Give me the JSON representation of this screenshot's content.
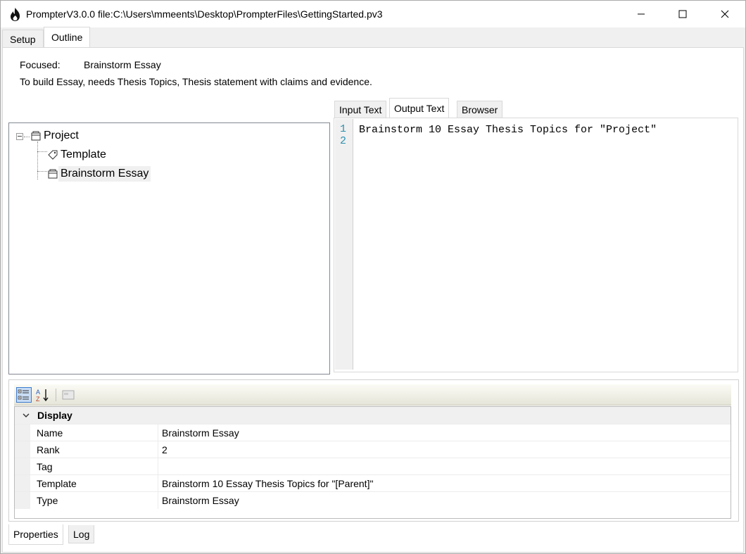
{
  "window": {
    "title": "PrompterV3.0.0 file:C:\\Users\\mmeents\\Desktop\\PrompterFiles\\GettingStarted.pv3"
  },
  "top_tabs": [
    {
      "label": "Setup",
      "active": false
    },
    {
      "label": "Outline",
      "active": true
    }
  ],
  "focus": {
    "label": "Focused:",
    "value": "Brainstorm Essay",
    "description": "To build Essay, needs Thesis Topics, Thesis statement with claims and evidence."
  },
  "tree": {
    "root": "Project",
    "children": [
      "Template",
      "Brainstorm Essay"
    ],
    "selected": "Brainstorm Essay"
  },
  "editor_tabs": [
    {
      "label": "Input Text",
      "active": false
    },
    {
      "label": "Output Text",
      "active": true
    },
    {
      "label": "Browser",
      "active": false
    }
  ],
  "editor": {
    "line_numbers": [
      "1",
      "2"
    ],
    "lines": [
      "Brainstorm 10 Essay Thesis Topics for \"Project\"",
      ""
    ]
  },
  "properties": {
    "category": "Display",
    "rows": [
      {
        "key": "Name",
        "value": "Brainstorm Essay"
      },
      {
        "key": "Rank",
        "value": "2"
      },
      {
        "key": "Tag",
        "value": ""
      },
      {
        "key": "Template",
        "value": "Brainstorm 10 Essay Thesis Topics for \"[Parent]\""
      },
      {
        "key": "Type",
        "value": "Brainstorm Essay"
      }
    ]
  },
  "bottom_tabs": [
    {
      "label": "Properties",
      "active": true
    },
    {
      "label": "Log",
      "active": false
    }
  ],
  "colors": {
    "line_number": "#2b91af",
    "selection_toolbar": "#3d7bd1"
  }
}
